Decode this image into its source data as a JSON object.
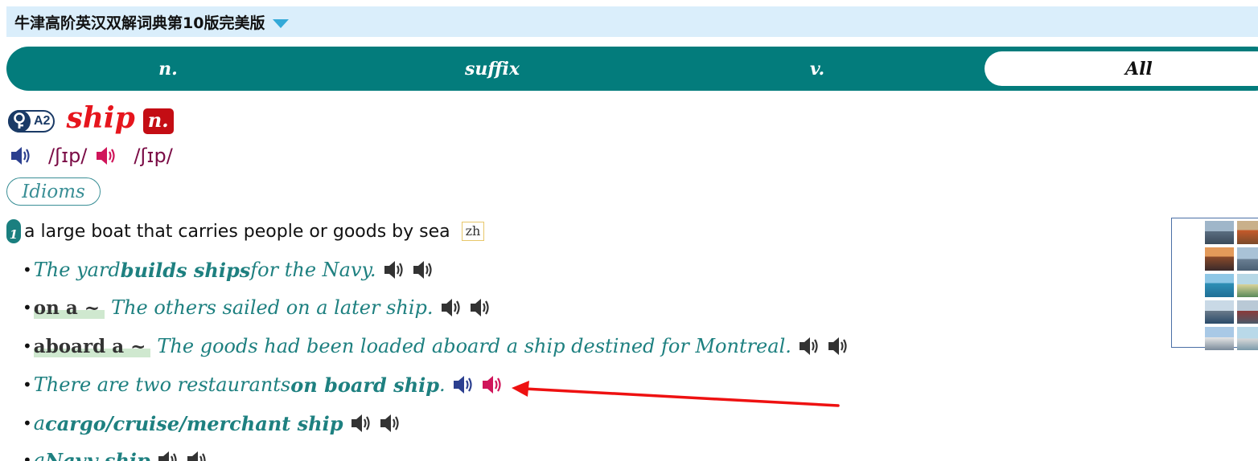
{
  "app": {
    "dictionary_title": "牛津高阶英汉双解词典第10版完美版"
  },
  "pos_tabs": [
    {
      "label": "n.",
      "active": false
    },
    {
      "label": "suffix",
      "active": false
    },
    {
      "label": "v.",
      "active": false
    },
    {
      "label": "All",
      "active": true
    }
  ],
  "entry": {
    "level": "A2",
    "headword": "ship",
    "pos": "n.",
    "pron_br": "/ʃɪp/",
    "pron_us": "/ʃɪp/",
    "idioms_label": "Idioms"
  },
  "sense": {
    "number": "1",
    "definition": "a large boat that carries people or goods by sea",
    "zh_label": "zh"
  },
  "examples": [
    {
      "parts": [
        "The yard ",
        "builds ships",
        " for the Navy."
      ]
    },
    {
      "cf": "on a ~",
      "text": "The others sailed on a later ship."
    },
    {
      "cf": "aboard a ~",
      "text": "The goods had been loaded aboard a ship destined for Montreal."
    },
    {
      "parts": [
        "There are two restaurants ",
        "on board ship",
        " ."
      ]
    },
    {
      "parts": [
        "a ",
        "cargo/cruise/merchant ship"
      ]
    },
    {
      "parts": [
        "a ",
        "Navy ship"
      ]
    }
  ],
  "colors": {
    "teal": "#037c7c",
    "headword_red": "#e6151d",
    "pos_red": "#c40d14",
    "example_teal": "#1e8080",
    "audio_br": "#2b3f8f",
    "audio_us": "#d0155a",
    "audio_grey": "#333333",
    "annotation_arrow": "#ee1111"
  },
  "icons": {
    "oxford3000": "key-icon",
    "audio": "speaker-icon",
    "dropdown": "triangle-down-icon"
  }
}
